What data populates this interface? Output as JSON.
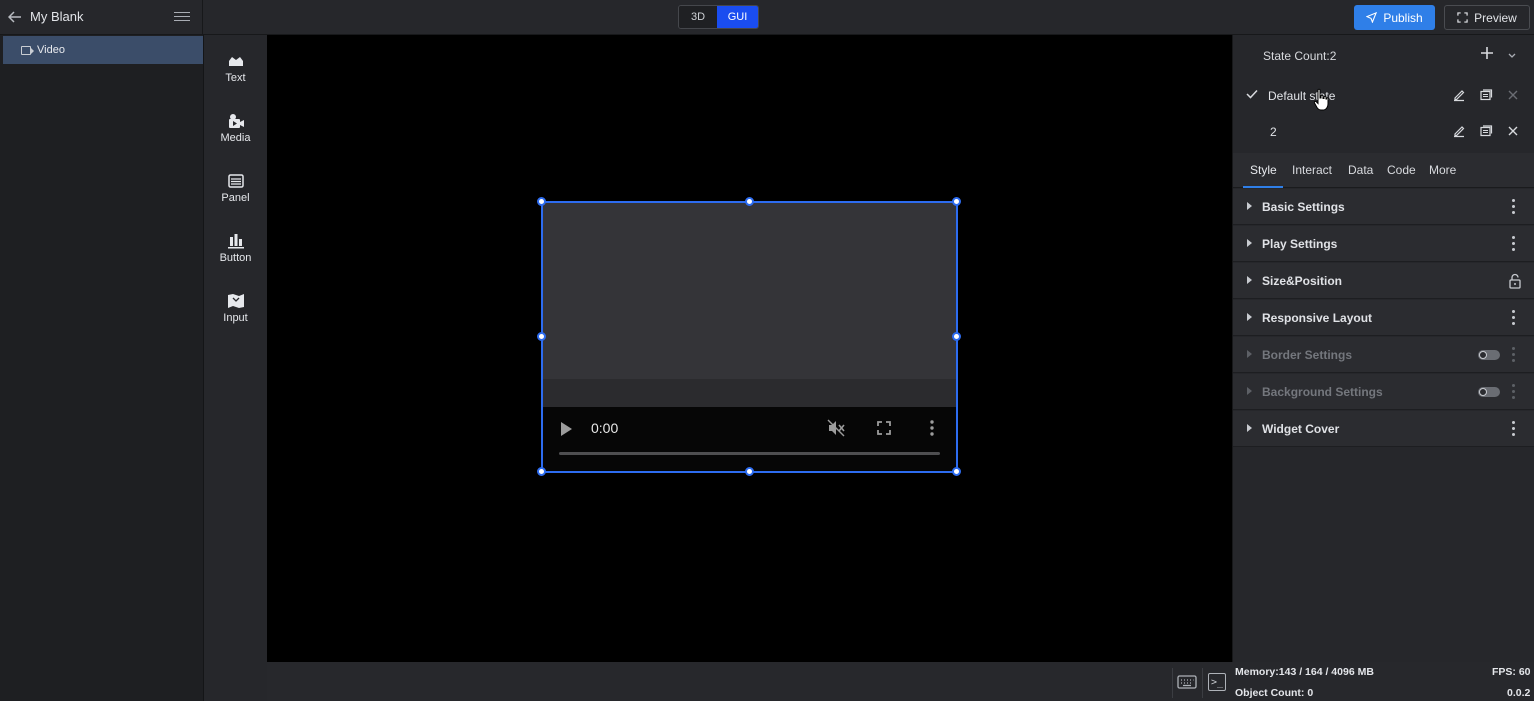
{
  "header": {
    "project_title": "My Blank",
    "mode_3d_label": "3D",
    "mode_gui_label": "GUI",
    "publish_label": "Publish",
    "preview_label": "Preview"
  },
  "layers": {
    "items": [
      {
        "label": "Video"
      }
    ]
  },
  "widgets": [
    {
      "label": "Text",
      "icon": "text-widget-icon"
    },
    {
      "label": "Media",
      "icon": "media-widget-icon"
    },
    {
      "label": "Panel",
      "icon": "panel-widget-icon"
    },
    {
      "label": "Button",
      "icon": "button-widget-icon"
    },
    {
      "label": "Input",
      "icon": "input-widget-icon"
    }
  ],
  "video": {
    "time": "0:00"
  },
  "states": {
    "count_label": "State Count:2",
    "items": [
      {
        "name": "Default state",
        "checked": true
      },
      {
        "name": "2",
        "checked": false
      }
    ]
  },
  "tabs": [
    "Style",
    "Interact",
    "Data",
    "Code",
    "More"
  ],
  "active_tab": "Style",
  "sections": [
    {
      "title": "Basic Settings",
      "control": "kebab"
    },
    {
      "title": "Play Settings",
      "control": "kebab"
    },
    {
      "title": "Size&Position",
      "control": "lock"
    },
    {
      "title": "Responsive Layout",
      "control": "kebab"
    },
    {
      "title": "Border Settings",
      "control": "toggle",
      "disabled": true
    },
    {
      "title": "Background Settings",
      "control": "toggle",
      "disabled": true
    },
    {
      "title": "Widget Cover",
      "control": "kebab"
    }
  ],
  "status": {
    "memory": "Memory:143 / 164 / 4096 MB",
    "fps": "FPS: 60",
    "objects": "Object Count: 0",
    "version": "0.0.2"
  },
  "colors": {
    "accent": "#2f7fe8",
    "selection": "#2d6cf0",
    "gui_active": "#1a4df0"
  }
}
